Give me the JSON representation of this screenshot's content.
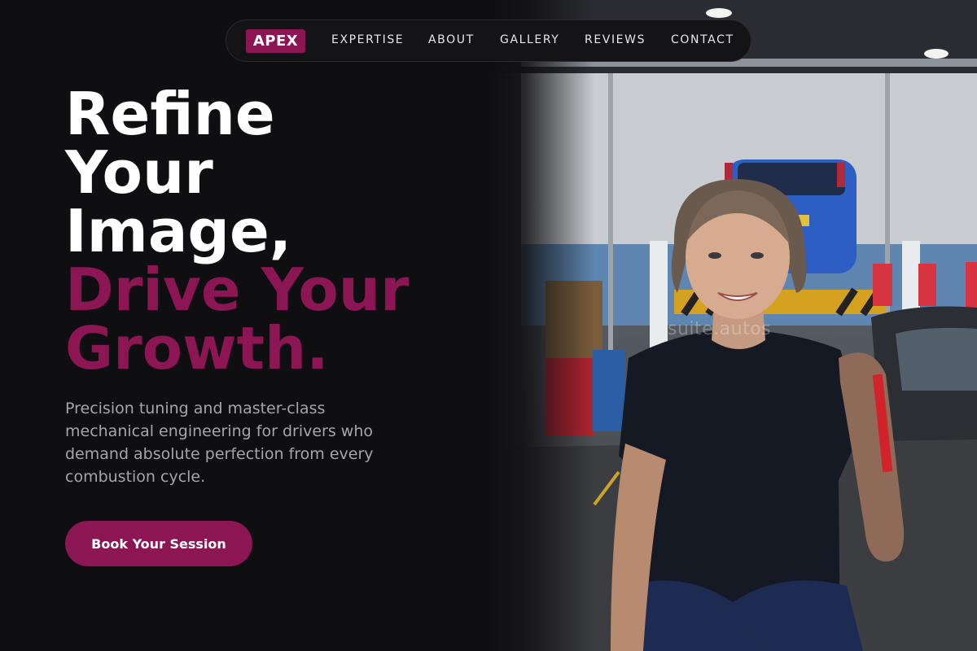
{
  "brand": {
    "logo_text": "APEX",
    "accent_color": "#8c1553"
  },
  "nav": {
    "links": [
      "EXPERTISE",
      "ABOUT",
      "GALLERY",
      "REVIEWS",
      "CONTACT"
    ]
  },
  "hero": {
    "headline_lines": [
      "Refine",
      "Your",
      "Image,"
    ],
    "headline_accent_lines": [
      "Drive Your",
      "Growth."
    ],
    "subcopy": "Precision tuning and master-class mechanical engineering for drivers who demand absolute perfection from every combustion cycle.",
    "cta_label": "Book Your Session",
    "photo_watermark": "suite.autos"
  }
}
